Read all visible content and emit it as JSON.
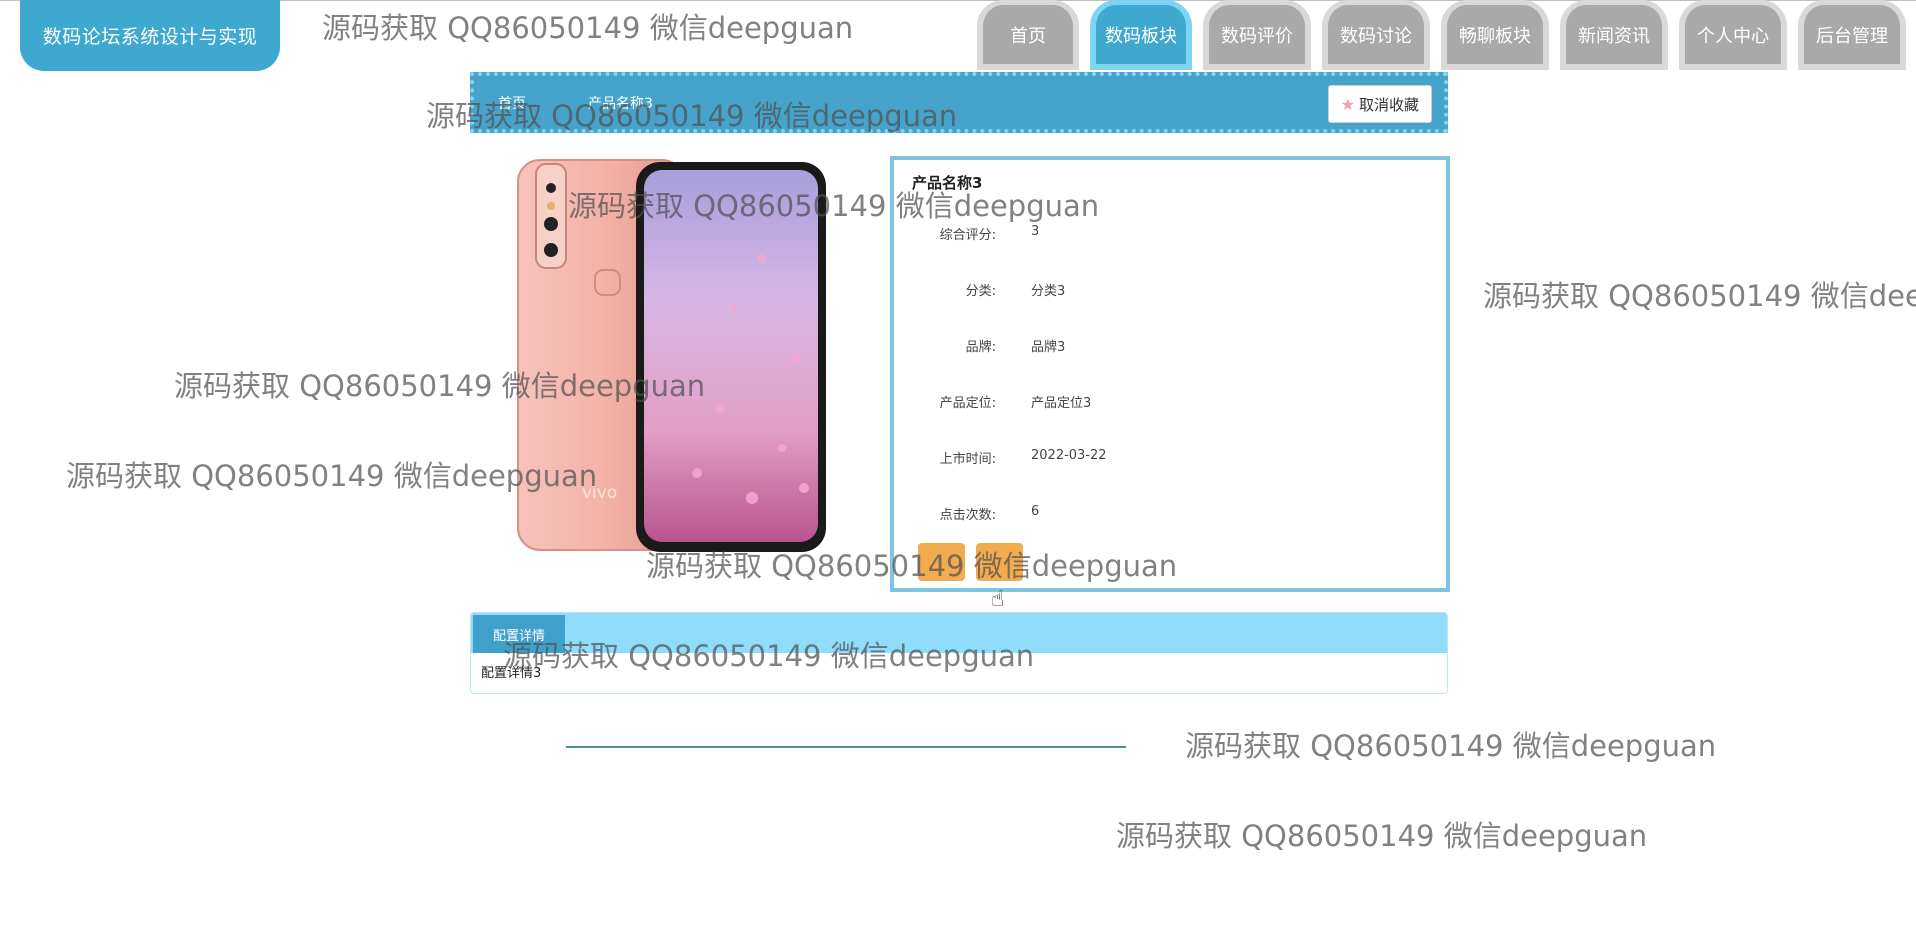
{
  "logo": {
    "title": "数码论坛系统设计与实现"
  },
  "nav": {
    "items": [
      "首页",
      "数码板块",
      "数码评价",
      "数码讨论",
      "畅聊板块",
      "新闻资讯",
      "个人中心",
      "后台管理"
    ],
    "active_index": 1
  },
  "breadcrumb": {
    "items": [
      "首页",
      "产品名称3"
    ]
  },
  "favorite_button": {
    "label": "取消收藏",
    "icon": "star-icon"
  },
  "product": {
    "brand_mark": "vivo",
    "name": "产品名称3",
    "fields": [
      {
        "label": "综合评分:",
        "value": "3"
      },
      {
        "label": "分类:",
        "value": "分类3"
      },
      {
        "label": "品牌:",
        "value": "品牌3"
      },
      {
        "label": "产品定位:",
        "value": "产品定位3"
      },
      {
        "label": "上市时间:",
        "value": "2022-03-22"
      },
      {
        "label": "点击次数:",
        "value": "6"
      }
    ]
  },
  "detail": {
    "tab_label": "配置详情",
    "content": "配置详情3"
  },
  "watermark": "源码获取 QQ86050149 微信deepguan",
  "colors": {
    "primary": "#3fa8cf",
    "nav_inactive": "#a9a9a9",
    "highlight": "#f2a23c",
    "panel_header": "#8fdcfb"
  }
}
